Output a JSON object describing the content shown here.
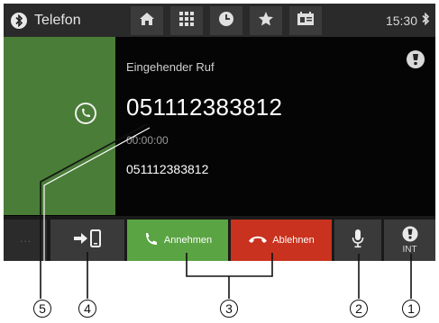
{
  "header": {
    "title": "Telefon",
    "clock": "15:30",
    "icons": [
      "bluetooth-icon",
      "home-icon",
      "grid-icon",
      "clock-icon",
      "star-icon",
      "contacts-icon"
    ]
  },
  "call": {
    "status": "Eingehender Ruf",
    "number": "051112383812",
    "duration": "00:00:00",
    "sub_number": "051112383812"
  },
  "bottom": {
    "more": "···",
    "accept": "Annehmen",
    "reject": "Ablehnen",
    "int": "INT"
  },
  "callouts": [
    "5",
    "4",
    "3",
    "2",
    "1"
  ],
  "colors": {
    "call_panel": "#4a7d38",
    "accept": "#5aa443",
    "reject": "#c8321e",
    "topbar": "#2a2a2a"
  }
}
